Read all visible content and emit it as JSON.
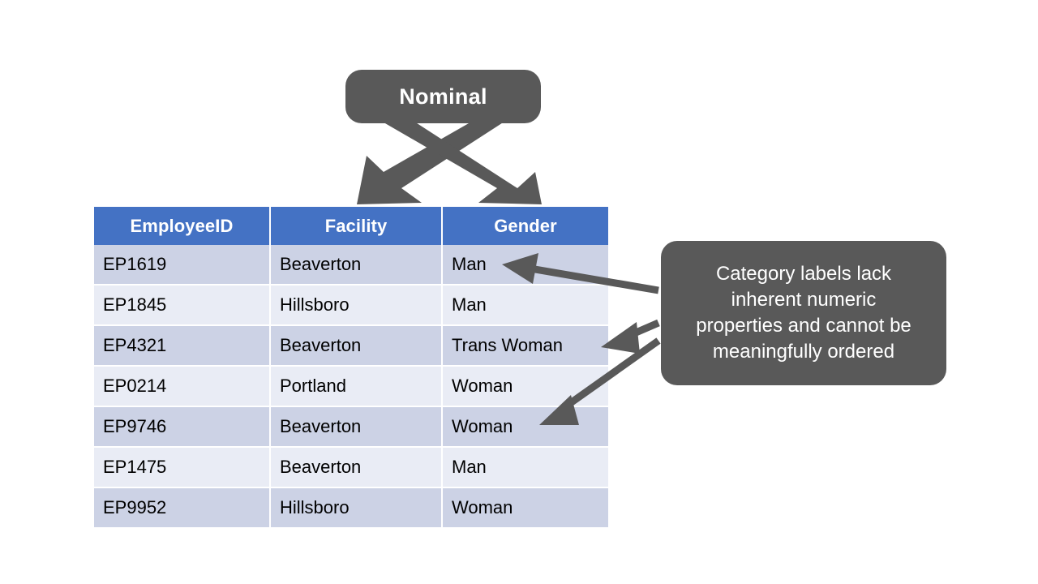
{
  "slide": {
    "background_color": "#ffffff",
    "accent_header_color": "#4472c4",
    "callout_color": "#595959",
    "row_band_dark": "#ccd2e5",
    "row_band_light": "#e9ecf5"
  },
  "nominal_callout": {
    "label": "Nominal"
  },
  "explain_callout": {
    "line1": "Category labels lack",
    "line2": "inherent numeric",
    "line3": "properties and cannot be",
    "line4": "meaningfully ordered"
  },
  "table": {
    "headers": [
      "EmployeeID",
      "Facility",
      "Gender"
    ],
    "rows": [
      [
        "EP1619",
        "Beaverton",
        "Man"
      ],
      [
        "EP1845",
        "Hillsboro",
        "Man"
      ],
      [
        "EP4321",
        "Beaverton",
        "Trans Woman"
      ],
      [
        "EP0214",
        "Portland",
        "Woman"
      ],
      [
        "EP9746",
        "Beaverton",
        "Woman"
      ],
      [
        "EP1475",
        "Beaverton",
        "Man"
      ],
      [
        "EP9952",
        "Hillsboro",
        "Woman"
      ]
    ]
  },
  "annotations": {
    "nominal_points_to": [
      "EmployeeID",
      "Gender"
    ],
    "explain_points_to": [
      "Man",
      "Trans Woman",
      "Woman"
    ]
  }
}
